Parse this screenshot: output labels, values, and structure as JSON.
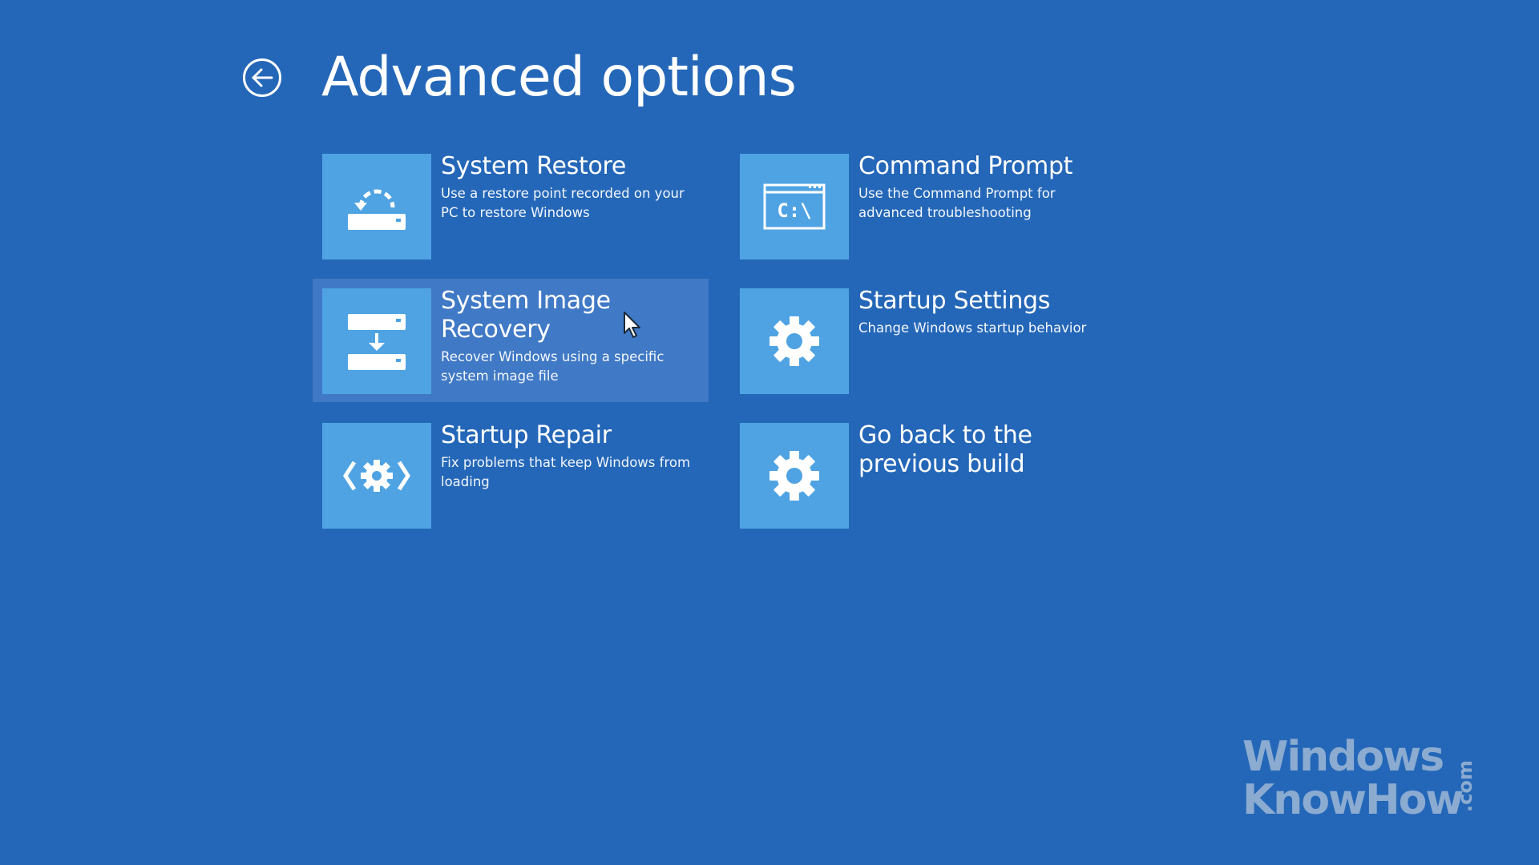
{
  "header": {
    "title": "Advanced options",
    "back_icon": "back-arrow-icon"
  },
  "options": [
    {
      "title": "System Restore",
      "description": "Use a restore point recorded on your PC to restore Windows",
      "icon": "system-restore-icon",
      "selected": false
    },
    {
      "title": "Command Prompt",
      "description": "Use the Command Prompt for advanced troubleshooting",
      "icon": "command-prompt-icon",
      "icon_text": "C:\\",
      "selected": false
    },
    {
      "title": "System Image Recovery",
      "description": "Recover Windows using a specific system image file",
      "icon": "system-image-recovery-icon",
      "selected": true
    },
    {
      "title": "Startup Settings",
      "description": "Change Windows startup behavior",
      "icon": "gear-icon",
      "selected": false
    },
    {
      "title": "Startup Repair",
      "description": "Fix problems that keep Windows from loading",
      "icon": "startup-repair-icon",
      "selected": false
    },
    {
      "title": "Go back to the previous build",
      "description": "",
      "icon": "gear-icon",
      "selected": false
    }
  ],
  "watermark": {
    "line1": "Windows",
    "line2": "KnowHow",
    "suffix": ".com"
  },
  "colors": {
    "background": "#2467b8",
    "tile": "#4fa3e3",
    "selected": "#4079c5",
    "text": "#ffffff"
  }
}
